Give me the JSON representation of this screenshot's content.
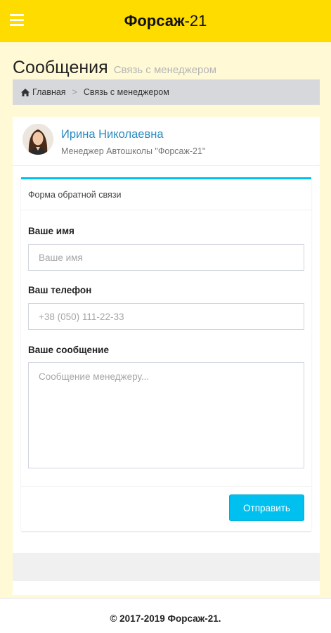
{
  "header": {
    "brand_name": "Форсаж",
    "brand_suffix": "-21",
    "menu_icon": "hamburger-menu-icon",
    "background": "#ffdc00"
  },
  "page": {
    "title": "Сообщения",
    "subtitle": "Связь с менеджером"
  },
  "breadcrumb": {
    "home_icon": "home-icon",
    "home_label": "Главная",
    "separator": ">",
    "current": "Связь с менеджером"
  },
  "manager": {
    "name": "Ирина Николаевна",
    "role": "Менеджер Автошколы \"Форсаж-21\""
  },
  "form": {
    "title": "Форма обратной связи",
    "name_label": "Ваше имя",
    "name_placeholder": "Ваше имя",
    "phone_label": "Ваш телефон",
    "phone_placeholder": "+38 (050) 111-22-33",
    "message_label": "Ваше сообщение",
    "message_placeholder": "Сообщение менеджеру...",
    "submit_label": "Отправить",
    "accent": "#00c0ef"
  },
  "footer": {
    "copyright": "© 2017-2019 Форсаж-21."
  }
}
